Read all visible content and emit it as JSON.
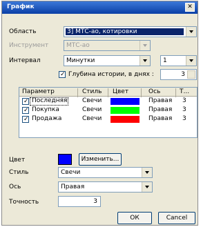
{
  "window": {
    "title": "График",
    "close_glyph": "✕"
  },
  "region": {
    "label": "Область",
    "value": "3] МТС-ао, котировки"
  },
  "instrument": {
    "label": "Инструмент",
    "value": "МТС-ао"
  },
  "interval": {
    "label": "Интервал",
    "value": "Минутки",
    "multiplier": "1"
  },
  "history": {
    "label": "Глубина истории, в днях :",
    "checked": true,
    "value": "3"
  },
  "table": {
    "columns": [
      "Параметр",
      "Стиль",
      "Цвет",
      "Ось",
      "Т..."
    ],
    "rows": [
      {
        "name": "Последняя",
        "style": "Свечи",
        "color": "#0000ff",
        "axis": "Правая",
        "t": "3"
      },
      {
        "name": "Покупка",
        "style": "Свечи",
        "color": "#00ff00",
        "axis": "Правая",
        "t": "3"
      },
      {
        "name": "Продажа",
        "style": "Свечи",
        "color": "#ff0000",
        "axis": "Правая",
        "t": "3"
      }
    ]
  },
  "color": {
    "label": "Цвет",
    "value": "#0000ff",
    "change_label": "Изменить..."
  },
  "style": {
    "label": "Стиль",
    "value": "Свечи"
  },
  "axis": {
    "label": "Ось",
    "value": "Правая"
  },
  "precision": {
    "label": "Точность",
    "value": "3"
  },
  "buttons": {
    "ok": "ОК",
    "cancel": "Cancel"
  }
}
